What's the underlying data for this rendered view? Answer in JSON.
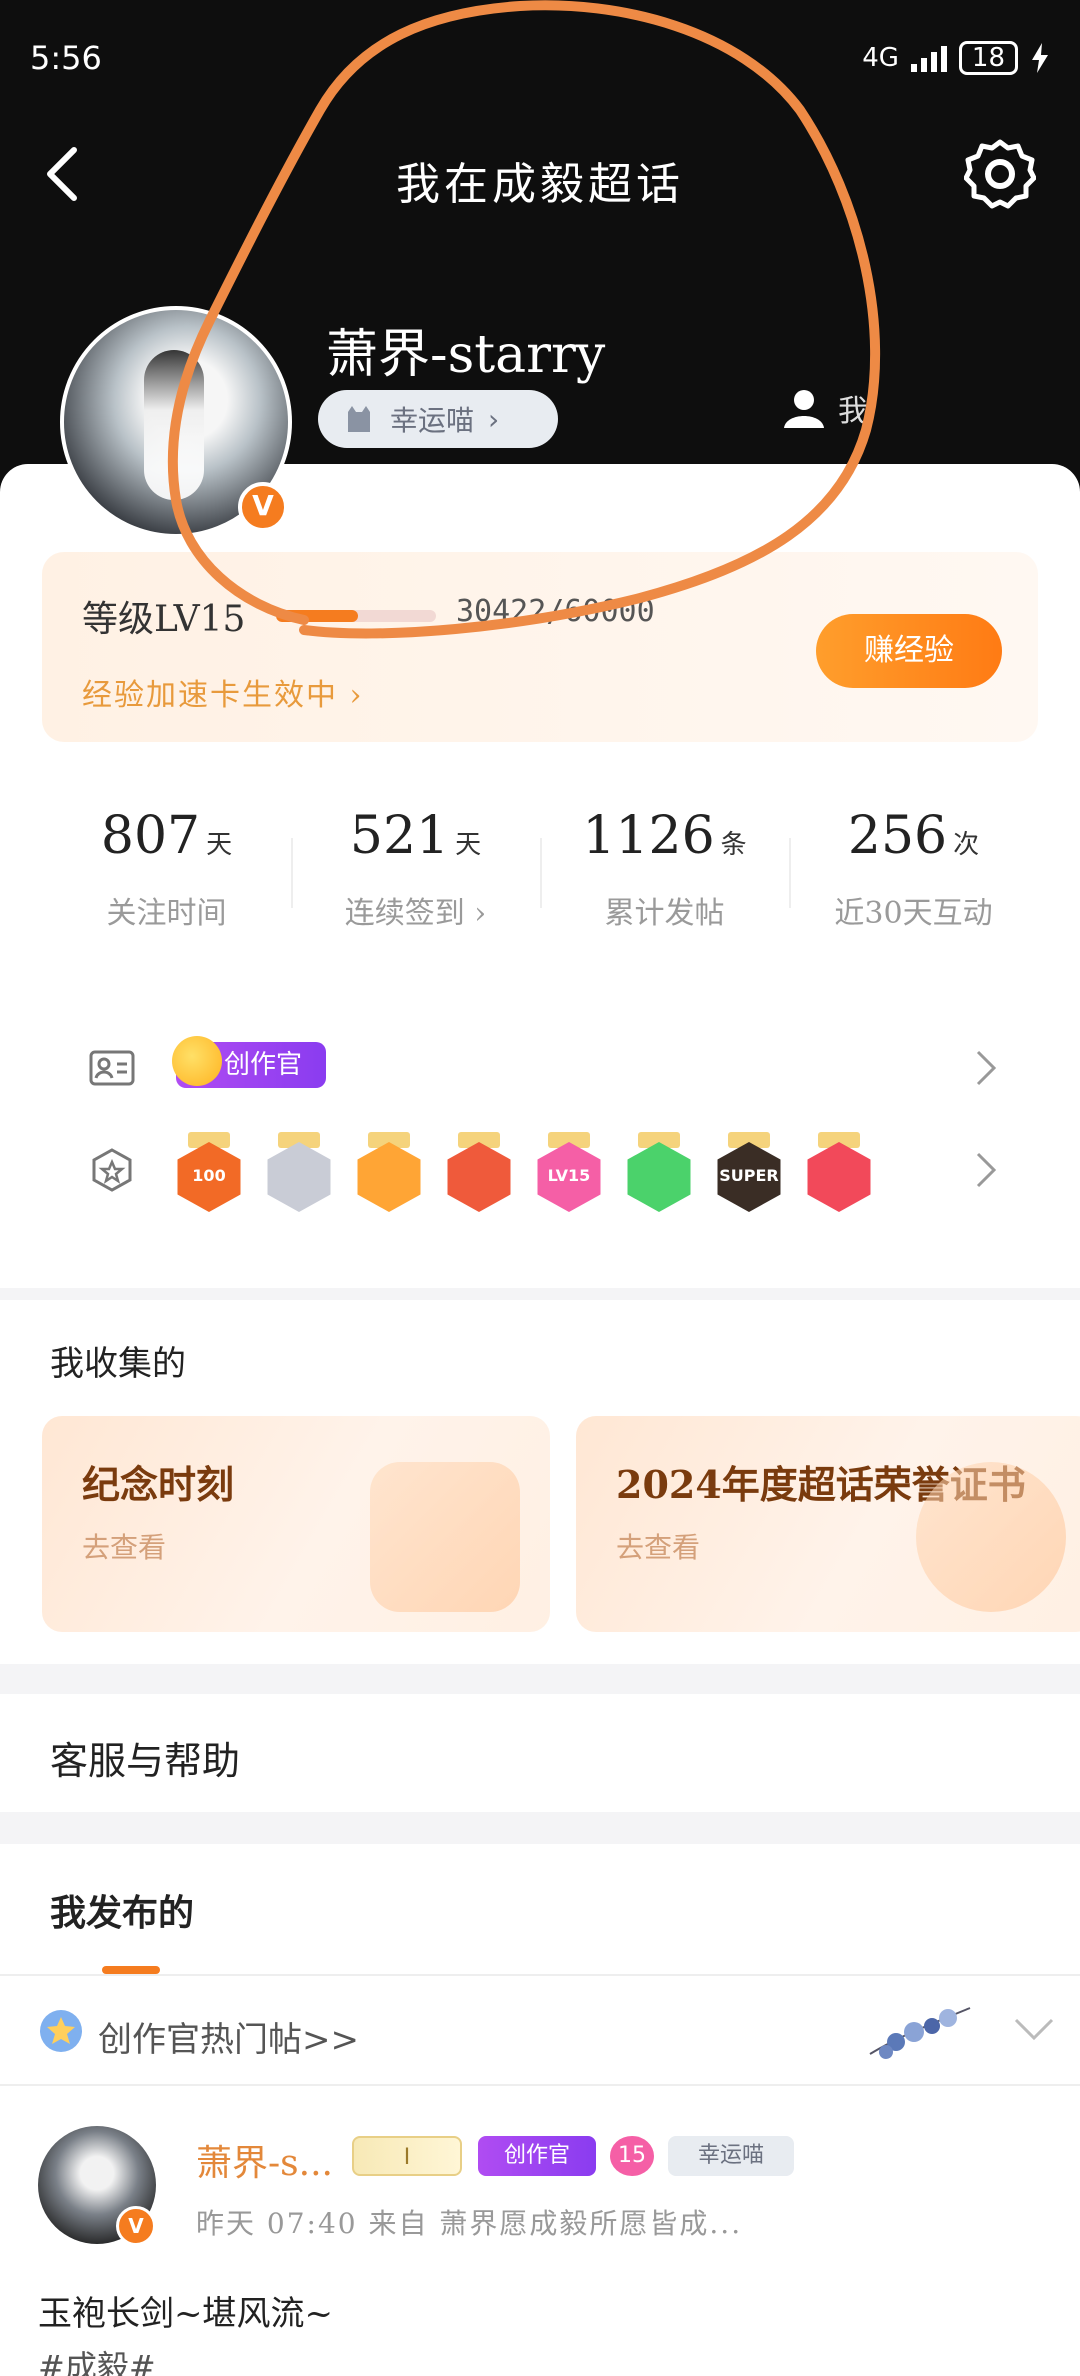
{
  "status_bar": {
    "time": "5:56",
    "network": "4G",
    "battery": "18"
  },
  "nav": {
    "title": "我在成毅超话"
  },
  "profile": {
    "username": "萧界-starry",
    "lucky_label": "幸运喵",
    "me_label": "我"
  },
  "level": {
    "label": "等级LV15",
    "exp": "30422/60000",
    "progress": 0.51,
    "boost": "经验加速卡生效中",
    "earn_label": "赚经验"
  },
  "stats": [
    {
      "num": "807",
      "unit": "天",
      "label": "关注时间"
    },
    {
      "num": "521",
      "unit": "天",
      "label": "连续签到"
    },
    {
      "num": "1126",
      "unit": "条",
      "label": "累计发帖"
    },
    {
      "num": "256",
      "unit": "次",
      "label": "近30天互动"
    }
  ],
  "badges": {
    "creator": "创作官",
    "medals": [
      {
        "text": "100",
        "color": "#f26a26"
      },
      {
        "text": "",
        "color": "#c9ccd6"
      },
      {
        "text": "",
        "color": "#ffa535"
      },
      {
        "text": "",
        "color": "#ef5a3b"
      },
      {
        "text": "LV15",
        "color": "#f55fa6"
      },
      {
        "text": "",
        "color": "#4bd26b"
      },
      {
        "text": "SUPER",
        "color": "#3a2d25"
      },
      {
        "text": "",
        "color": "#f2495a"
      }
    ]
  },
  "collect": {
    "title": "我收集的",
    "cards": [
      {
        "name": "纪念时刻",
        "sub": "去查看"
      },
      {
        "name": "2024年度超话荣誉证书",
        "sub": "去查看"
      }
    ]
  },
  "help": {
    "title": "客服与帮助"
  },
  "posts": {
    "title": "我发布的",
    "hot": "创作官热门帖>>",
    "post": {
      "name": "萧界-s...",
      "tags": [
        "I",
        "创作官",
        "15",
        "幸运喵"
      ],
      "meta": "昨天 07:40  来自 萧界愿成毅所愿皆成...",
      "content": "玉袍长剑~堪风流~",
      "topic": "#成毅#"
    }
  },
  "colors": {
    "accent": "#f57c1f",
    "annotation": "#ee8a45"
  }
}
